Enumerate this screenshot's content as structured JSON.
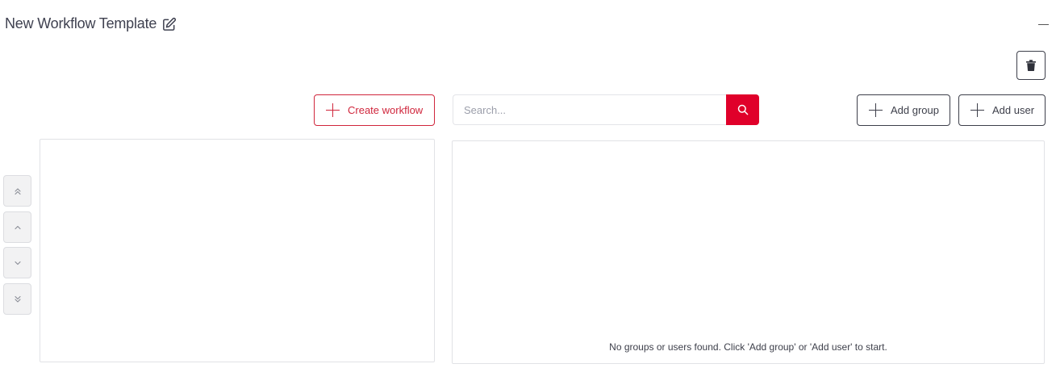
{
  "header": {
    "title": "New Workflow Template",
    "edit_icon": "pencil-square-icon",
    "minimize_icon": "minus-icon"
  },
  "toolbar": {
    "delete_icon": "trash-icon",
    "create_workflow_label": "Create workflow",
    "search_placeholder": "Search...",
    "search_icon": "search-icon",
    "add_group_label": "Add group",
    "add_user_label": "Add user"
  },
  "order_controls": [
    {
      "icon": "chevrons-double-up-icon"
    },
    {
      "icon": "chevron-up-icon"
    },
    {
      "icon": "chevron-down-icon"
    },
    {
      "icon": "chevrons-double-down-icon"
    }
  ],
  "assignees_panel": {
    "empty_message": "No groups or users found. Click 'Add group' or 'Add user' to start."
  },
  "colors": {
    "accent": "#e0002a",
    "accent_border": "#d0263c",
    "text": "#3d3f4a",
    "border": "#e1e2e6"
  }
}
